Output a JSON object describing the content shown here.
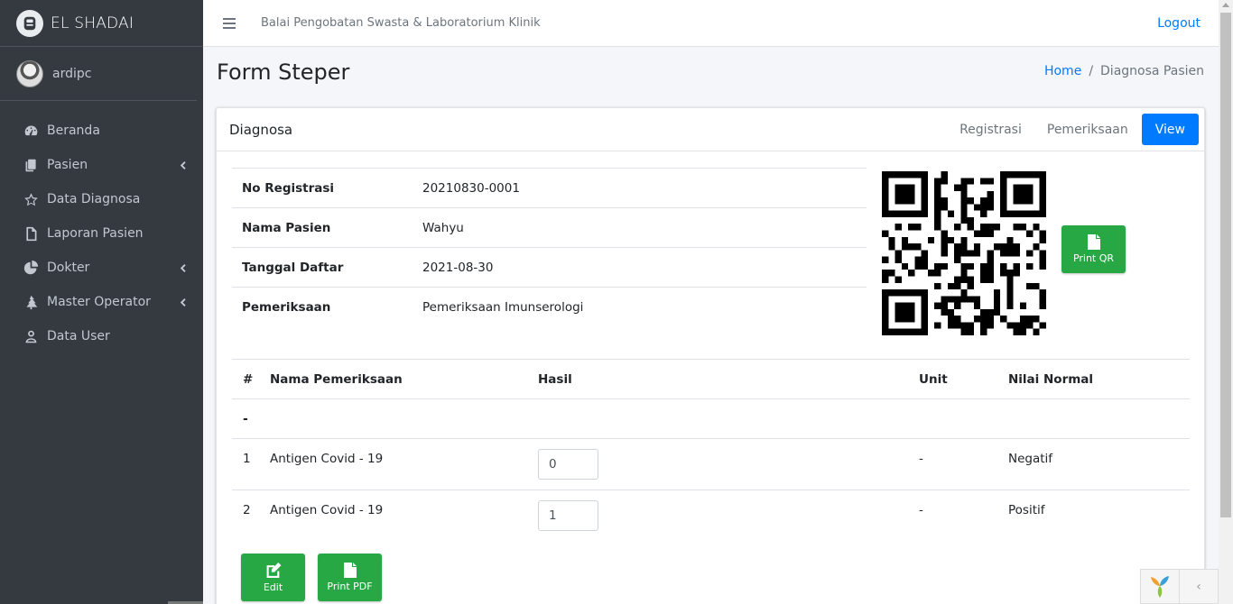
{
  "sidebar": {
    "brand": "EL SHADAI",
    "user": "ardipc",
    "items": [
      {
        "label": "Beranda"
      },
      {
        "label": "Pasien"
      },
      {
        "label": "Data Diagnosa"
      },
      {
        "label": "Laporan Pasien"
      },
      {
        "label": "Dokter"
      },
      {
        "label": "Master Operator"
      },
      {
        "label": "Data User"
      }
    ]
  },
  "topbar": {
    "title": "Balai Pengobatan Swasta & Laboratorium Klinik",
    "logout": "Logout"
  },
  "page": {
    "title": "Form Steper",
    "breadcrumb": {
      "home": "Home",
      "sep": "/",
      "current": "Diagnosa Pasien"
    }
  },
  "card": {
    "title": "Diagnosa",
    "tabs": [
      {
        "label": "Registrasi"
      },
      {
        "label": "Pemeriksaan"
      },
      {
        "label": "View"
      }
    ]
  },
  "info": [
    {
      "key": "No Registrasi",
      "value": "20210830-0001"
    },
    {
      "key": "Nama Pasien",
      "value": "Wahyu"
    },
    {
      "key": "Tanggal Daftar",
      "value": "2021-08-30"
    },
    {
      "key": "Pemeriksaan",
      "value": "Pemeriksaan Imunserologi"
    }
  ],
  "buttons": {
    "print_qr": "Print QR",
    "edit": "Edit",
    "print_pdf": "Print PDF"
  },
  "results": {
    "headers": {
      "num": "#",
      "name": "Nama Pemeriksaan",
      "hasil": "Hasil",
      "unit": "Unit",
      "normal": "Nilai Normal"
    },
    "group": "-",
    "rows": [
      {
        "num": "1",
        "name": "Antigen Covid - 19",
        "hasil": "0",
        "unit": "-",
        "normal": "Negatif"
      },
      {
        "num": "2",
        "name": "Antigen Covid - 19",
        "hasil": "1",
        "unit": "-",
        "normal": "Positif"
      }
    ]
  },
  "dev": {
    "toggle": "‹"
  }
}
